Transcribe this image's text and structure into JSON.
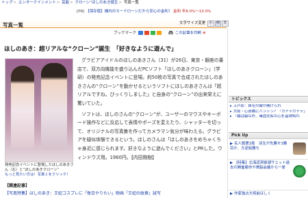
{
  "breadcrumb": {
    "items": [
      "トップ",
      "エンターテインメント",
      "芸能",
      "クローン“ほしのあき誕生",
      "写真一覧"
    ]
  },
  "pr_line": {
    "tag": "[PR]",
    "text": "【保存版】機内のカードローンだから安心の金利！",
    "rate": "金利 年8.0%〜10.0%"
  },
  "section": {
    "title": "写真一覧",
    "text_size_label": "文字サイズ変更",
    "sizes": [
      "小",
      "中",
      "大"
    ],
    "active_size": "中"
  },
  "toolbar": {
    "bookmark_label": "ブックマーク",
    "print_label": "この記事を印刷",
    "print_accent": "⊕"
  },
  "article": {
    "headline": "ほしのあき：超リアルな“クローン”誕生　「好きなように遊んで」",
    "paragraphs": [
      "グラビアアイドルのほしのあきさん（31）が26日、東京・銀座の書店で、双方向機能を盛り込んだPCソフト「ほしのあきクローン」（学研）の発売記念イベントに登場。約50枚の写真で合成されたほしのあきさんの“クローン”を動かせるというソフトにほしのあきさんは「超リアルですね。びっくりしました」と自身の“クローン”の出来栄えに驚いていた。",
      "ソフトは、ほしのさんの“クローン”が、ユーザーのマウスやキーボード操作などに反応して表情やポーズを変えたり、シャッターを切って、オリジナルの写真集を作ってカメラマン気分が味わえる。グラビアを疑似体験できるという。ほしのさんは「ほしのあきをめちゃくちゃ身近に感じられます。好きなように遊んでください」とPRした。ウィンドウズ用。1960円。【内田剛樹】"
    ]
  },
  "photo": {
    "caption": "発売記念イベントに登場したほしのあきさん（左）と“ほしのあきクローン”",
    "more_link": "もっと見たい方は！写真１をクリック！"
  },
  "related": {
    "heading": "【関連記事】",
    "link": "【写真特集】ほしのあき：王妃コスプレに「毎日やりたい」映画「王妃の紋章」試写"
  },
  "sidebar": {
    "topics_heading": "トピックス",
    "topics": [
      "上戸彩：自宅の鍵が開けられ",
      "大阪・心斎橋にバンシン？「ガチャガチャ」",
      "「腸は脳以外、毒固化私の心を基律知れ"
    ],
    "pickup_heading": "Pick Up",
    "pickups": [
      {
        "text": "名人戦第3局　羽生が先勝す3勝目か、大逆転勝ち"
      },
      {
        "text": "【特集】北海道洞爺湖サミット過去の開催都市や首脳会議から一挙"
      },
      {
        "text": "作家独占大将前ほしく"
      }
    ]
  },
  "colors": {
    "accent": "#e39a3a",
    "link": "#1a3fa6",
    "pr_accent": "#c02020"
  },
  "icons": [
    "bookmark-icons",
    "print-icon",
    "topic-bullet-icon"
  ]
}
